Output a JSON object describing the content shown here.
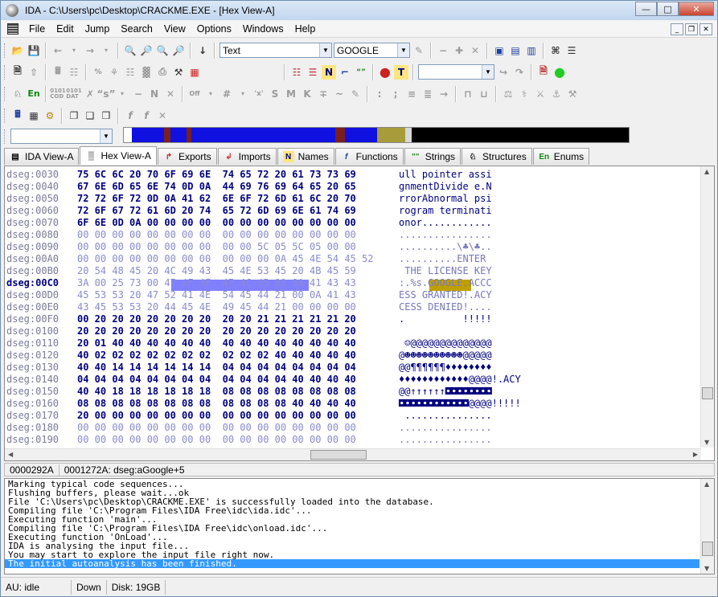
{
  "window": {
    "title": "IDA - C:\\Users\\pc\\Desktop\\CRACKME.EXE - [Hex View-A]",
    "minimize": "—",
    "maximize": "□",
    "close": "✕"
  },
  "menu": [
    "File",
    "Edit",
    "Jump",
    "Search",
    "View",
    "Options",
    "Windows",
    "Help"
  ],
  "toolbar": {
    "text_combo": "Text",
    "search_combo": "GOOGLE",
    "segment_combo": "",
    "nav_combo": ""
  },
  "tabs": [
    {
      "label": "IDA View-A",
      "icon": "ida-view-icon",
      "glyph": "▤"
    },
    {
      "label": "Hex View-A",
      "icon": "hex-view-icon",
      "glyph": "▒",
      "active": true
    },
    {
      "label": "Exports",
      "icon": "exports-icon",
      "glyph": "↱"
    },
    {
      "label": "Imports",
      "icon": "imports-icon",
      "glyph": "↲"
    },
    {
      "label": "Names",
      "icon": "names-icon",
      "glyph": "N"
    },
    {
      "label": "Functions",
      "icon": "functions-icon",
      "glyph": "f"
    },
    {
      "label": "Strings",
      "icon": "strings-icon",
      "glyph": "\"\""
    },
    {
      "label": "Structures",
      "icon": "structures-icon",
      "glyph": "♘"
    },
    {
      "label": "Enums",
      "icon": "enums-icon",
      "glyph": "En"
    }
  ],
  "hex": {
    "rows": [
      {
        "addr": "dseg:0030",
        "bytes": "75 6C 6C 20 70 6F 69 6E  74 65 72 20 61 73 73 69",
        "ascii": "ull pointer assi"
      },
      {
        "addr": "dseg:0040",
        "bytes": "67 6E 6D 65 6E 74 0D 0A  44 69 76 69 64 65 20 65",
        "ascii": "gnmentDivide e.N"
      },
      {
        "addr": "dseg:0050",
        "bytes": "72 72 6F 72 0D 0A 41 62  6E 6F 72 6D 61 6C 20 70",
        "ascii": "rrorAbnormal psi"
      },
      {
        "addr": "dseg:0060",
        "bytes": "72 6F 67 72 61 6D 20 74  65 72 6D 69 6E 61 74 69",
        "ascii": "rogram terminati"
      },
      {
        "addr": "dseg:0070",
        "bytes": "6F 6E 0D 0A 00 00 00 00  00 00 00 00 00 00 00 00",
        "ascii": "onor............"
      },
      {
        "addr": "dseg:0080",
        "bytes": "00 00 00 00 00 00 00 00  00 00 00 00 00 00 00 00",
        "ascii": "................",
        "zero": true
      },
      {
        "addr": "dseg:0090",
        "bytes": "00 00 00 00 00 00 00 00  00 00 5C 05 5C 05 00 00",
        "ascii": "..........\\♣\\♣..",
        "zero": true
      },
      {
        "addr": "dseg:00A0",
        "bytes": "00 00 00 00 00 00 00 00  00 00 00 0A 45 4E 54 45 52",
        "ascii": "..........ENTER",
        "zero": true
      },
      {
        "addr": "dseg:00B0",
        "bytes": "20 54 48 45 20 4C 49 43  45 4E 53 45 20 4B 45 59",
        "ascii": " THE LICENSE KEY",
        "zero": true
      },
      {
        "addr": "dseg:00C0",
        "bytes": "3A 00 25 73 00 47 4F 4F  47 4C 45 00 0A 41 43 43",
        "ascii": ":.%s.GOOGLE.ACCC",
        "cur": true,
        "zero": true
      },
      {
        "addr": "dseg:00D0",
        "bytes": "45 53 53 20 47 52 41 4E  54 45 44 21 00 0A 41 43",
        "ascii": "ESS GRANTED!.ACY",
        "zero": true
      },
      {
        "addr": "dseg:00E0",
        "bytes": "43 45 53 53 20 44 45 4E  49 45 44 21 00 00 00 00",
        "ascii": "CESS DENIED!....",
        "zero": true
      },
      {
        "addr": "dseg:00F0",
        "bytes": "00 20 20 20 20 20 20 20  20 20 21 21 21 21 21 20",
        "ascii": ".          !!!!!"
      },
      {
        "addr": "dseg:0100",
        "bytes": "20 20 20 20 20 20 20 20  20 20 20 20 20 20 20 20",
        "ascii": ""
      },
      {
        "addr": "dseg:0110",
        "bytes": "20 01 40 40 40 40 40 40  40 40 40 40 40 40 40 40",
        "ascii": " ☺@@@@@@@@@@@@@@"
      },
      {
        "addr": "dseg:0120",
        "bytes": "40 02 02 02 02 02 02 02  02 02 02 40 40 40 40 40",
        "ascii": "@☻☻☻☻☻☻☻☻☻☻@@@@@"
      },
      {
        "addr": "dseg:0130",
        "bytes": "40 40 14 14 14 14 14 14  04 04 04 04 04 04 04 04",
        "ascii": "@@¶¶¶¶¶¶♦♦♦♦♦♦♦♦"
      },
      {
        "addr": "dseg:0140",
        "bytes": "04 04 04 04 04 04 04 04  04 04 04 04 40 40 40 40",
        "ascii": "♦♦♦♦♦♦♦♦♦♦♦♦@@@@!.ACY"
      },
      {
        "addr": "dseg:0150",
        "bytes": "40 40 18 18 18 18 18 18  08 08 08 08 08 08 08 08",
        "ascii": "@@↑↑↑↑↑↑◘◘◘◘◘◘◘◘"
      },
      {
        "addr": "dseg:0160",
        "bytes": "08 08 08 08 08 08 08 08  08 08 08 08 40 40 40 40",
        "ascii": "◘◘◘◘◘◘◘◘◘◘◘◘@@@@!!!!!"
      },
      {
        "addr": "dseg:0170",
        "bytes": "20 00 00 00 00 00 00 00  00 00 00 00 00 00 00 00",
        "ascii": " ..............."
      },
      {
        "addr": "dseg:0180",
        "bytes": "00 00 00 00 00 00 00 00  00 00 00 00 00 00 00 00",
        "ascii": "................",
        "zero": true
      },
      {
        "addr": "dseg:0190",
        "bytes": "00 00 00 00 00 00 00 00  00 00 00 00 00 00 00 00",
        "ascii": "................",
        "zero": true
      }
    ]
  },
  "hexstatus": {
    "offset": "0000292A",
    "location": "0001272A: dseg:aGoogle+5"
  },
  "output": {
    "lines": [
      "Marking typical code sequences...",
      "Flushing buffers, please wait...ok",
      "File 'C:\\Users\\pc\\Desktop\\CRACKME.EXE' is successfully loaded into the database.",
      "Compiling file 'C:\\Program Files\\IDA Free\\idc\\ida.idc'...",
      "Executing function 'main'...",
      "Compiling file 'C:\\Program Files\\IDA Free\\idc\\onload.idc'...",
      "Executing function 'OnLoad'...",
      "IDA is analysing the input file...",
      "You may start to explore the input file right now.",
      "The initial autoanalysis has been finished."
    ]
  },
  "status": {
    "au": "AU:  idle",
    "direction": "Down",
    "disk": "Disk: 19GB"
  },
  "colors": {
    "accent": "#3399ff",
    "hex_bytes": "#000080",
    "highlight": "#8080ff"
  }
}
